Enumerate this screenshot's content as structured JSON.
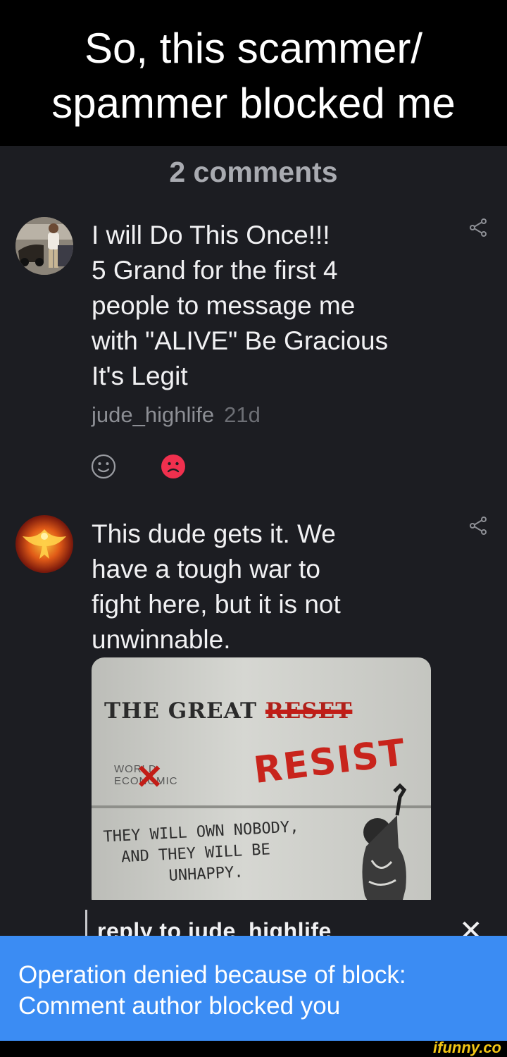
{
  "caption": {
    "line1": "So, this scammer/",
    "line2": "spammer blocked me"
  },
  "comments_header": "2 comments",
  "comments": [
    {
      "avatar_icon": "user-photo-avatar",
      "text_lines": [
        "I will Do This Once!!!",
        "5 Grand for the first 4",
        "people to message me",
        "with \"ALIVE\" Be Gracious",
        "It's Legit"
      ],
      "author": "jude_highlife",
      "time": "21d",
      "reactions": [
        "neutral-face-icon",
        "sad-face-icon"
      ]
    },
    {
      "avatar_icon": "phoenix-avatar",
      "text_lines": [
        "This dude gets it. We",
        "have a tough war to",
        "fight here, but it is not",
        "unwinnable."
      ],
      "image": {
        "heading": "THE GREAT",
        "heading_struck": "RESET",
        "logo_text": "WORLD ECONOMIC",
        "resist": "RESIST",
        "line1": "THEY WILL OWN NOBODY,",
        "line2": "AND THEY WILL BE",
        "line3": "UNHAPPY."
      }
    }
  ],
  "reply_bar": {
    "label": "reply to jude_highlife",
    "close_icon": "close-icon"
  },
  "toast": {
    "line1": "Operation denied because of block:",
    "line2": "Comment author blocked you"
  },
  "watermark": "ifunny.co",
  "colors": {
    "background": "#1c1d22",
    "toast": "#3b8cf3",
    "sad_reaction": "#f0304e",
    "watermark": "#f3c715"
  }
}
